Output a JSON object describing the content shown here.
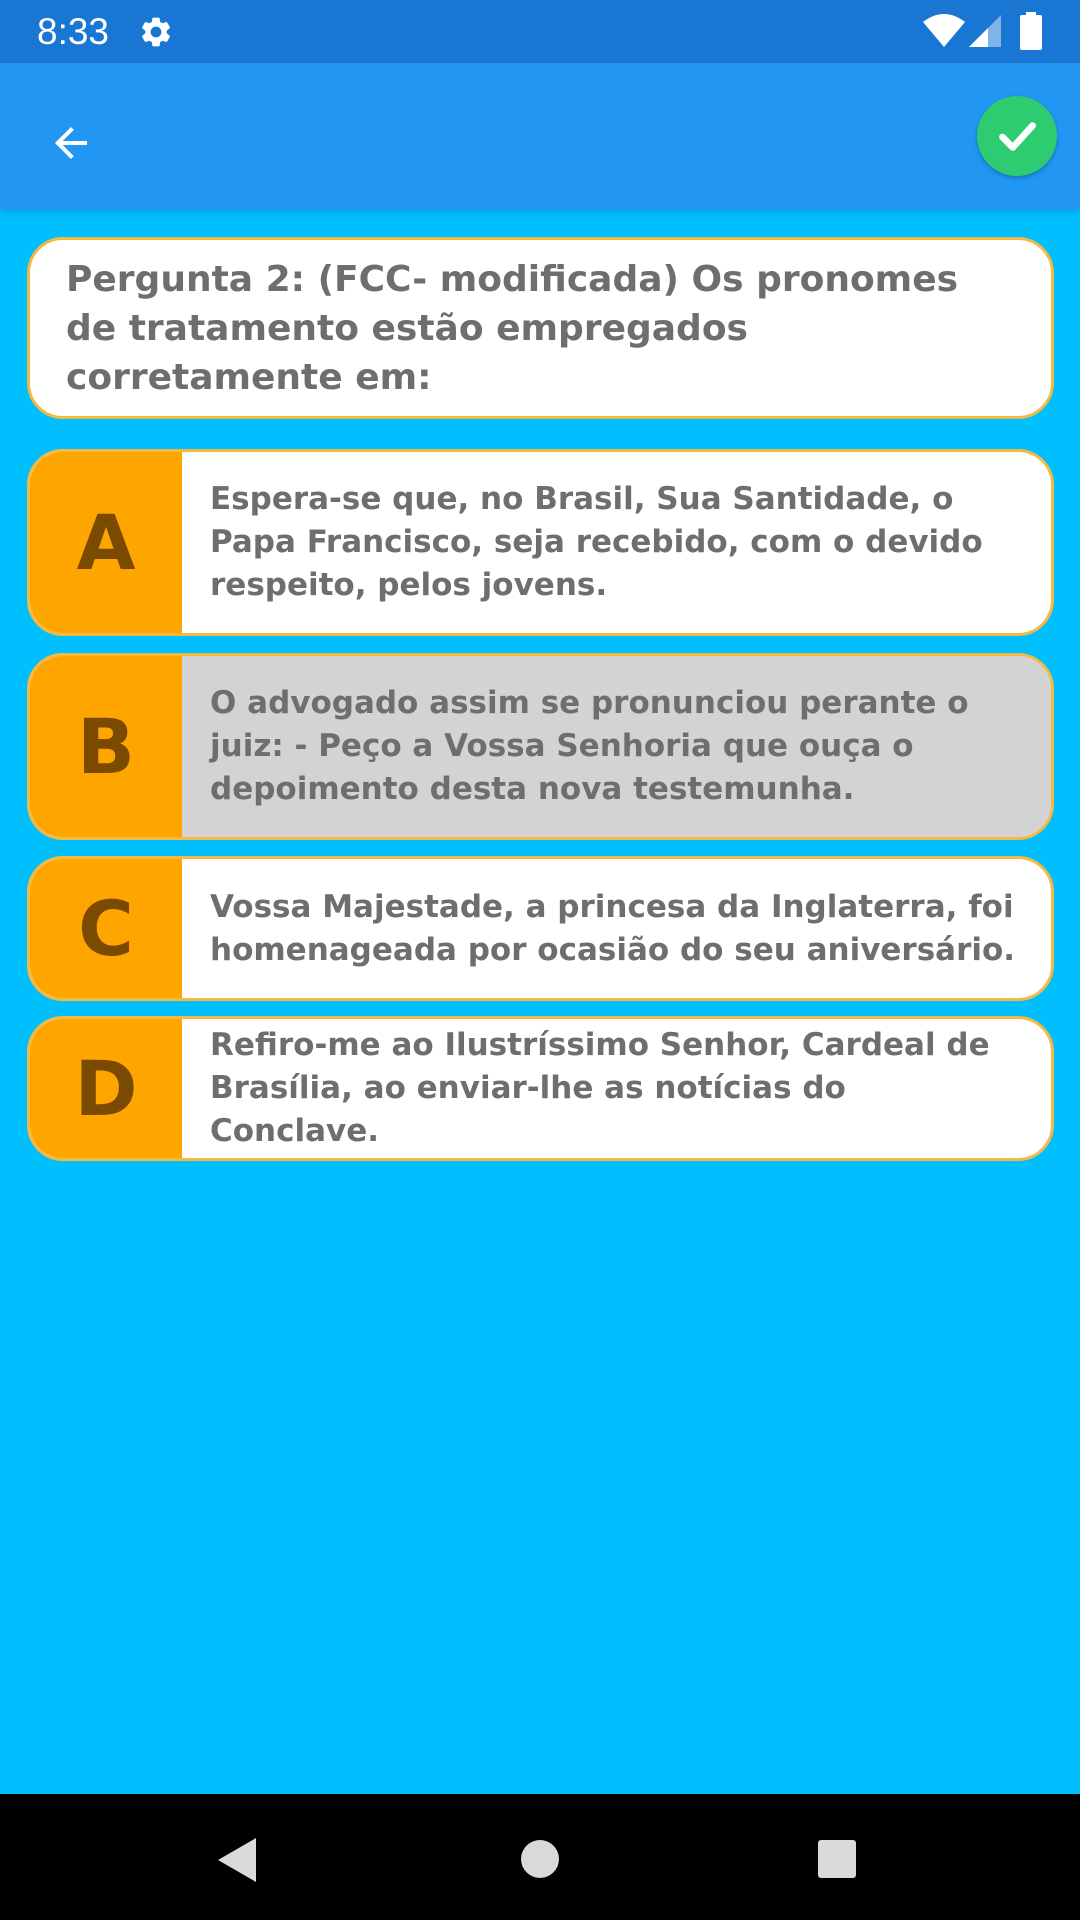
{
  "status_bar": {
    "time": "8:33",
    "icons": [
      "gear-icon",
      "wifi-icon",
      "cell-signal-icon",
      "battery-icon"
    ]
  },
  "app_bar": {
    "back_icon": "arrow-left-icon",
    "confirm_icon": "check-icon",
    "colors": {
      "background": "#2196F3",
      "confirm": "#2ECC71"
    }
  },
  "question": {
    "text": "Pergunta 2: (FCC- modificada) Os pronomes de tratamento estão empregados corretamente em:"
  },
  "options": [
    {
      "letter": "A",
      "text": "Espera-se que, no Brasil, Sua Santidade, o Papa Francisco, seja recebido, com o devido respeito, pelos jovens.",
      "selected": false
    },
    {
      "letter": "B",
      "text": "O advogado assim se pronunciou perante o juiz: - Peço a Vossa Senhoria que ouça o depoimento desta nova testemunha.",
      "selected": true
    },
    {
      "letter": "C",
      "text": "Vossa Majestade, a princesa da Inglaterra, foi homenageada por ocasião do seu aniversário.",
      "selected": false
    },
    {
      "letter": "D",
      "text": "Refiro-me ao Ilustríssimo Senhor, Cardeal de Brasília, ao enviar-lhe as notícias do Conclave.",
      "selected": false
    }
  ],
  "colors": {
    "screen_background": "#00BFFF",
    "letter_background": "#FFA500",
    "selected_background": "#D3D3D3",
    "card_border": "#F5B942"
  },
  "nav_bar": {
    "icons": [
      "nav-back-icon",
      "nav-home-icon",
      "nav-recents-icon"
    ]
  }
}
